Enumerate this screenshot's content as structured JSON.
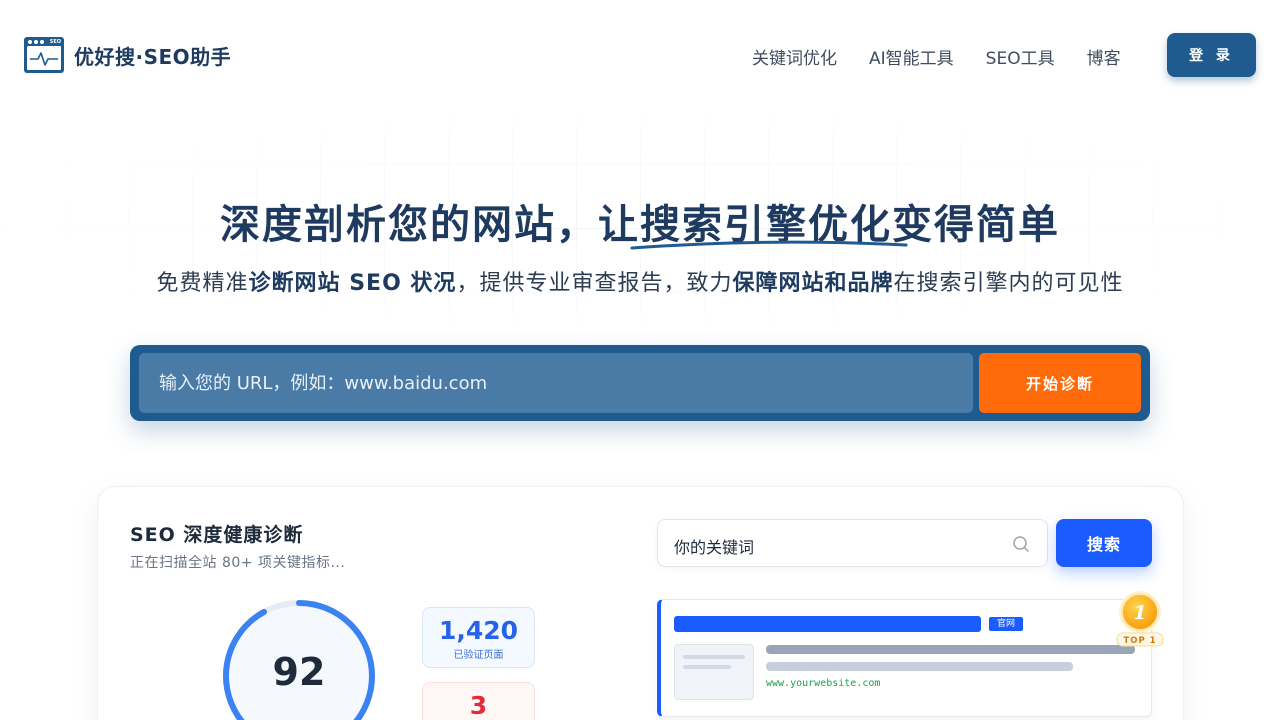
{
  "brand": {
    "name": "优好搜·SEO助手",
    "icon_tag": "SEO"
  },
  "nav": {
    "items": [
      "关键词优化",
      "AI智能工具",
      "SEO工具",
      "博客"
    ],
    "login_label": "登 录"
  },
  "hero": {
    "headline_part1": "深度剖析您的网站，",
    "headline_part2": "让搜索引擎优化变得简单",
    "sub_part1": "免费精准",
    "sub_bold1": "诊断网站 SEO 状况",
    "sub_part2": "，提供专业审查报告，致力",
    "sub_bold2": "保障网站和品牌",
    "sub_part3": "在搜索引擎内的可见性"
  },
  "search": {
    "placeholder": "输入您的 URL，例如：www.baidu.com",
    "button_label": "开始诊断"
  },
  "diagnosis": {
    "title": "SEO 深度健康诊断",
    "subtitle": "正在扫描全站 80+ 项关键指标...",
    "score": "92",
    "score_fraction": 0.92,
    "stats": [
      {
        "value": "1,420",
        "label": "已验证页面"
      },
      {
        "value": "3",
        "label": ""
      }
    ]
  },
  "serp": {
    "keyword": "你的关键词",
    "button_label": "搜索",
    "badge": "官网",
    "url": "www.yourwebsite.com",
    "medal_rank": "1",
    "medal_label": "TOP 1"
  },
  "colors": {
    "primary": "#1f5b8f",
    "accent_orange": "#ff6b0a",
    "accent_blue": "#1a5cff",
    "green_url": "#16a34a"
  }
}
